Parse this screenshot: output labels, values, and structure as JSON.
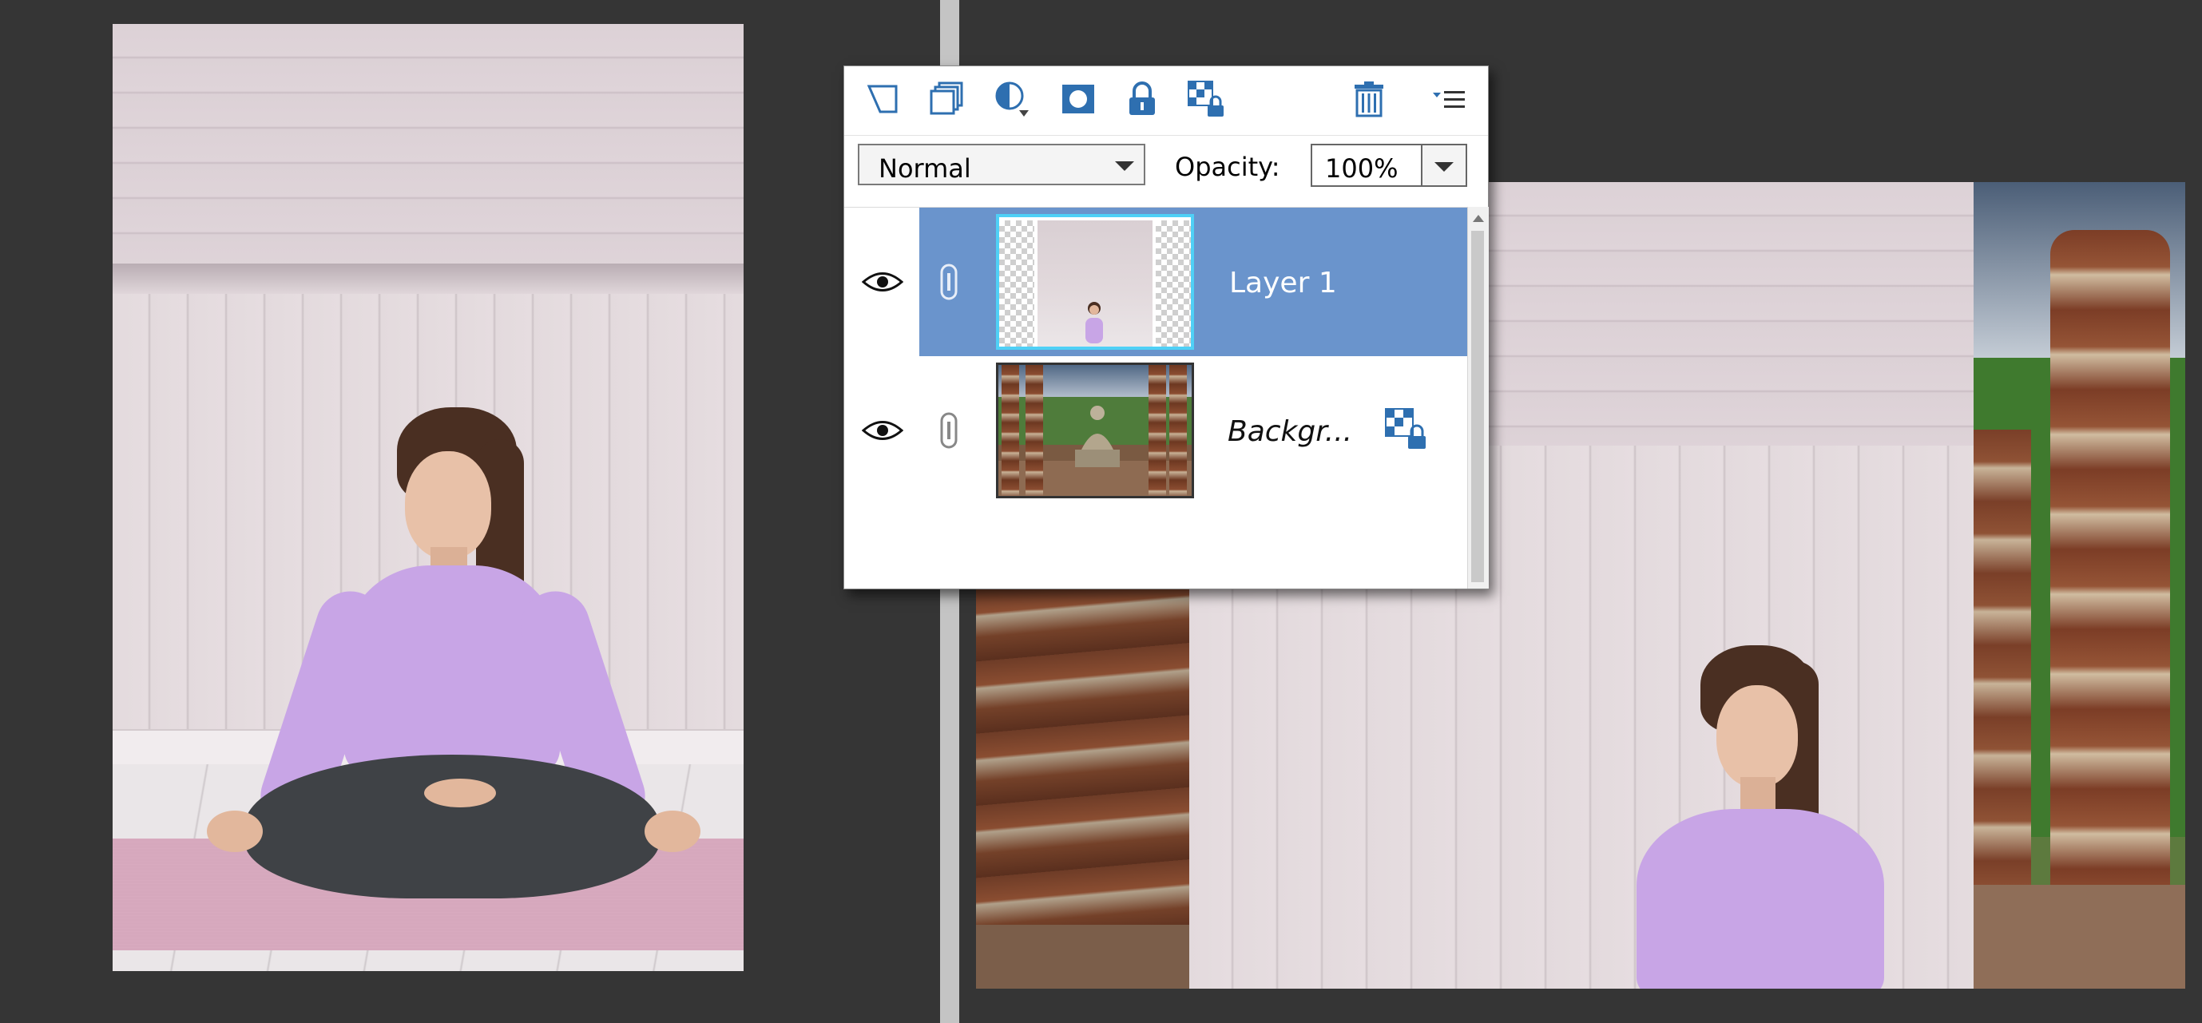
{
  "layers_panel": {
    "toolbar": {
      "new_layer": "new-layer-icon",
      "duplicate_layer": "duplicate-layer-icon",
      "adjustment_layer": "adjustment-layer-icon",
      "layer_mask": "layer-mask-icon",
      "lock_all": "lock-icon",
      "lock_transparency": "lock-transparency-icon",
      "delete_layer": "trash-icon",
      "panel_menu": "panel-menu-icon"
    },
    "blend_mode": "Normal",
    "opacity_label": "Opacity:",
    "opacity_value": "100%",
    "layers": [
      {
        "name": "Layer 1",
        "visible": true,
        "selected": true,
        "thumbnail": "yoga woman on transparent background"
      },
      {
        "name": "Backgr...",
        "visible": true,
        "selected": false,
        "locked": true,
        "thumbnail": "temple ruins with buddha statue"
      }
    ],
    "colors": {
      "selection": "#6a94cc",
      "thumb_border": "#4fd0f6"
    }
  }
}
